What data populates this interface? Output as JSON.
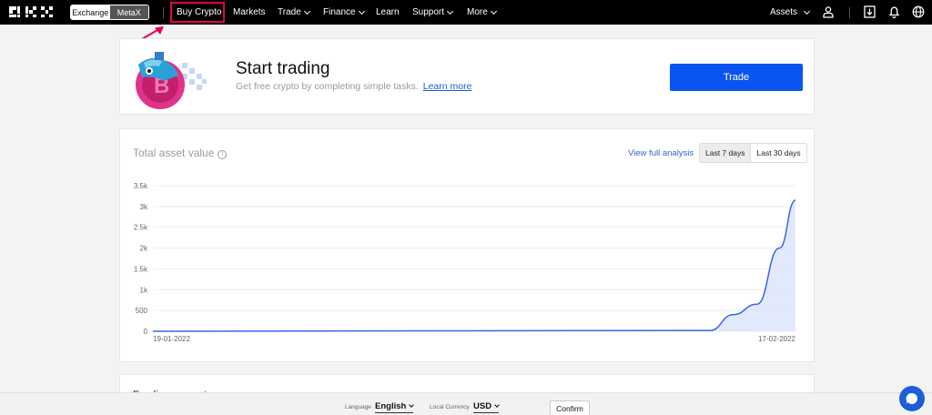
{
  "nav": {
    "switch": {
      "exchange": "Exchange",
      "metax": "MetaX"
    },
    "items": [
      {
        "label": "Buy Crypto",
        "has_chevron": false
      },
      {
        "label": "Markets",
        "has_chevron": false
      },
      {
        "label": "Trade",
        "has_chevron": true
      },
      {
        "label": "Finance",
        "has_chevron": true
      },
      {
        "label": "Learn",
        "has_chevron": false
      },
      {
        "label": "Support",
        "has_chevron": true
      },
      {
        "label": "More",
        "has_chevron": true
      }
    ],
    "assets_label": "Assets",
    "icons": [
      "user-icon",
      "download-icon",
      "bell-icon",
      "globe-icon"
    ]
  },
  "promo": {
    "title": "Start trading",
    "subtitle": "Get free crypto by completing simple tasks.",
    "link": "Learn more",
    "button": "Trade"
  },
  "asset_card": {
    "title": "Total asset value",
    "view_link": "View full analysis",
    "ranges": [
      {
        "label": "Last 7 days",
        "active": true
      },
      {
        "label": "Last 30 days",
        "active": false
      }
    ]
  },
  "chart_data": {
    "type": "area",
    "title": "",
    "xlabel": "",
    "ylabel": "",
    "y_ticks": [
      "0",
      "500",
      "1k",
      "1.5k",
      "2k",
      "2.5k",
      "3k",
      "3.5k"
    ],
    "ylim": [
      0,
      3500
    ],
    "x_labels": [
      "19-01-2022",
      "17-02-2022"
    ],
    "x": [
      "19-01-2022",
      "13-02-2022",
      "14-02-2022",
      "15-02-2022",
      "16-02-2022",
      "17-02-2022"
    ],
    "values": [
      0,
      20,
      400,
      650,
      2000,
      3150
    ],
    "color": "#3a67e8",
    "fill": "#dbe3fb",
    "grid": true
  },
  "card3": {
    "title": "Funding account"
  },
  "bottom": {
    "language_label": "Language",
    "language_value": "English",
    "currency_label": "Local Currency",
    "currency_value": "USD",
    "confirm": "Confirm"
  },
  "annotation": {
    "color": "#e5004c"
  }
}
